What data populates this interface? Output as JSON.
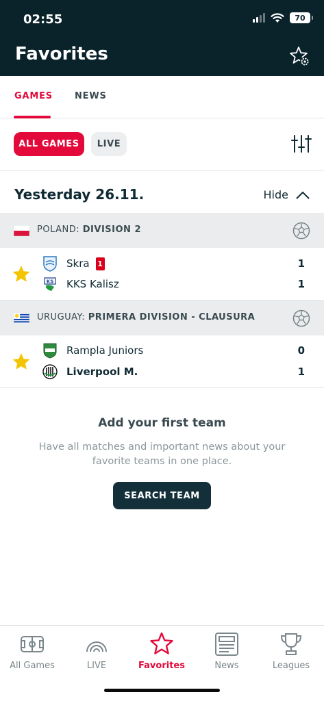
{
  "status_bar": {
    "time": "02:55",
    "battery": "70"
  },
  "header": {
    "title": "Favorites",
    "settings_icon": "star-gear-icon"
  },
  "tabs": [
    {
      "label": "GAMES",
      "active": true
    },
    {
      "label": "NEWS",
      "active": false
    }
  ],
  "filters": {
    "chips": [
      {
        "label": "ALL GAMES",
        "active": true
      },
      {
        "label": "LIVE",
        "active": false
      }
    ],
    "filter_icon": "sliders-icon"
  },
  "section": {
    "date": "Yesterday 26.11.",
    "toggle_label": "Hide"
  },
  "leagues": [
    {
      "country": "POLAND:",
      "name": "DIVISION 2",
      "match": {
        "home": {
          "name": "Skra",
          "red_cards": "1",
          "score": "1",
          "bold": false
        },
        "away": {
          "name": "KKS Kalisz",
          "score": "1",
          "bold": false
        }
      }
    },
    {
      "country": "URUGUAY:",
      "name": "PRIMERA DIVISION - CLAUSURA",
      "match": {
        "home": {
          "name": "Rampla Juniors",
          "score": "0",
          "bold": false
        },
        "away": {
          "name": "Liverpool M.",
          "score": "1",
          "bold": true
        }
      }
    }
  ],
  "empty_state": {
    "title": "Add your first team",
    "text": "Have all matches and important news about your favorite teams in one place.",
    "button": "SEARCH TEAM"
  },
  "bottom_nav": [
    {
      "label": "All Games",
      "icon": "field-icon"
    },
    {
      "label": "LIVE",
      "icon": "broadcast-icon"
    },
    {
      "label": "Favorites",
      "icon": "star-icon",
      "active": true
    },
    {
      "label": "News",
      "icon": "newspaper-icon"
    },
    {
      "label": "Leagues",
      "icon": "trophy-icon"
    }
  ],
  "colors": {
    "accent": "#e3093b",
    "header_bg": "#0a232b",
    "star": "#f5c400",
    "button": "#13303a"
  }
}
